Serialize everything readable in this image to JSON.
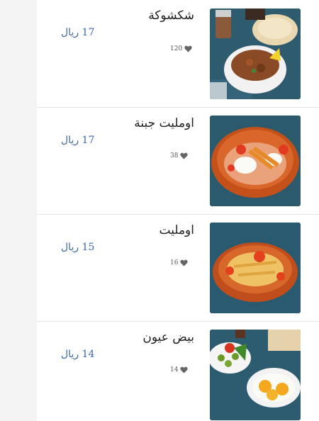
{
  "menu": {
    "items": [
      {
        "name": "شكشوكة",
        "price": "17 ريال",
        "likes": "120",
        "image": "shakshuka-photo"
      },
      {
        "name": "اومليت جبنة",
        "price": "17 ريال",
        "likes": "38",
        "image": "cheese-omelette-photo"
      },
      {
        "name": "اومليت",
        "price": "15 ريال",
        "likes": "16",
        "image": "omelette-photo"
      },
      {
        "name": "بيض عيون",
        "price": "14 ريال",
        "likes": "14",
        "image": "fried-eggs-photo"
      }
    ]
  },
  "colors": {
    "price": "#3f6aa8",
    "background": "#f4f4f4",
    "divider": "#e3e3e3"
  }
}
